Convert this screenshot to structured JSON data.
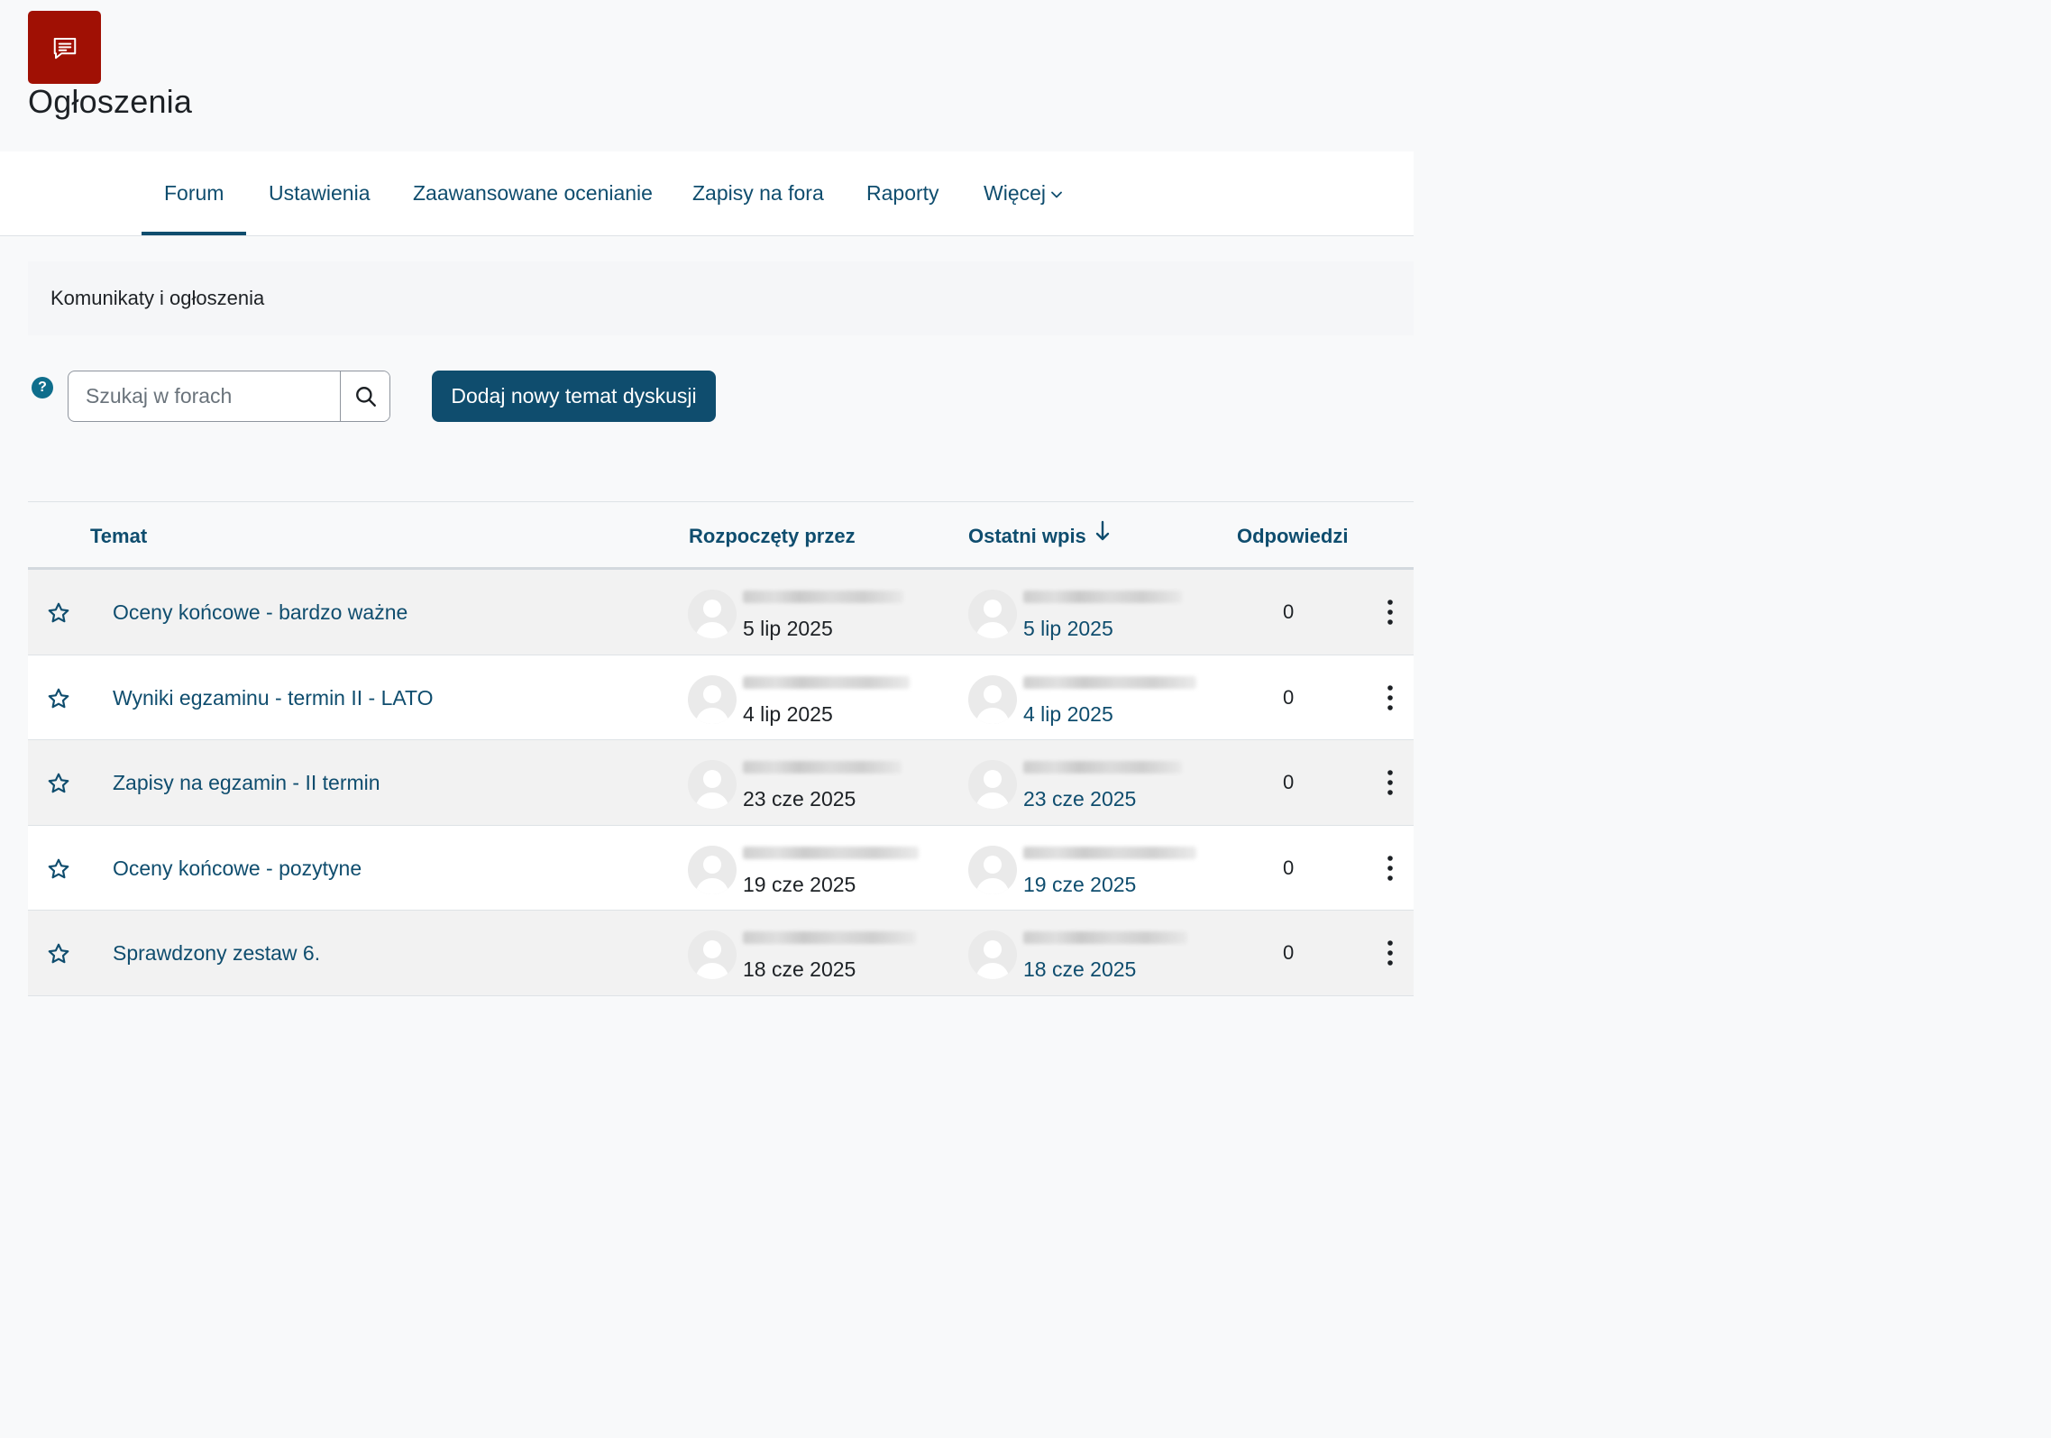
{
  "page": {
    "title": "Ogłoszenia",
    "icon": "forum-icon",
    "accent_color": "#a01004"
  },
  "tabs": [
    {
      "label": "Forum",
      "active": true
    },
    {
      "label": "Ustawienia"
    },
    {
      "label": "Zaawansowane ocenianie"
    },
    {
      "label": "Zapisy na fora"
    },
    {
      "label": "Raporty"
    },
    {
      "label": "Więcej"
    }
  ],
  "description": "Komunikaty i ogłoszenia",
  "search": {
    "placeholder": "Szukaj w forach",
    "value": ""
  },
  "add_button_label": "Dodaj nowy temat dyskusji",
  "table": {
    "headers": {
      "topic": "Temat",
      "started_by": "Rozpoczęty przez",
      "last_post": "Ostatni wpis",
      "replies": "Odpowiedzi"
    },
    "sort": {
      "column": "last_post",
      "direction": "desc"
    },
    "rows": [
      {
        "topic": "Oceny końcowe - bardzo ważne",
        "started_date": "5 lip 2025",
        "last_date": "5 lip 2025",
        "replies": "0"
      },
      {
        "topic": "Wyniki egzaminu - termin II - LATO",
        "started_date": "4 lip 2025",
        "last_date": "4 lip 2025",
        "replies": "0"
      },
      {
        "topic": "Zapisy na egzamin - II termin",
        "started_date": "23 cze 2025",
        "last_date": "23 cze 2025",
        "replies": "0"
      },
      {
        "topic": "Oceny końcowe - pozytyne",
        "started_date": "19 cze 2025",
        "last_date": "19 cze 2025",
        "replies": "0"
      },
      {
        "topic": "Sprawdzony zestaw 6.",
        "started_date": "18 cze 2025",
        "last_date": "18 cze 2025",
        "replies": "0"
      }
    ]
  },
  "colors": {
    "primary": "#0f4d6e",
    "help": "#0f6e8c"
  }
}
